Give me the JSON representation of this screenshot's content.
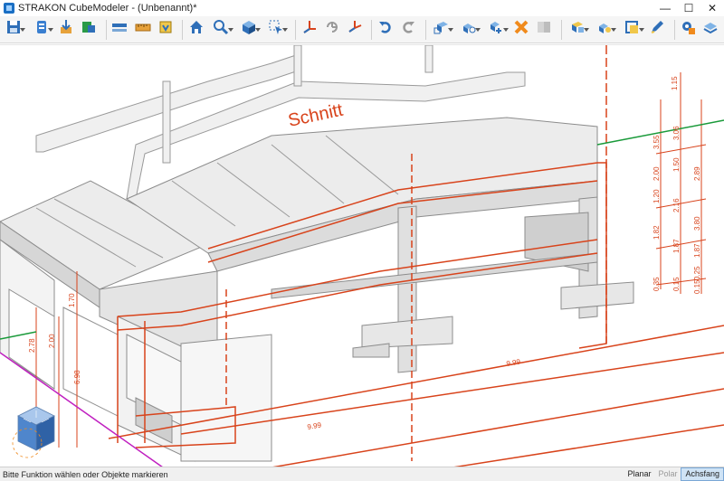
{
  "window": {
    "title": "STRAKON CubeModeler - (Unbenannt)*",
    "minimize_glyph": "—",
    "maximize_glyph": "☐",
    "close_glyph": "✕"
  },
  "toolbar": {
    "buttons": [
      {
        "name": "save-icon",
        "dropdown": true
      },
      {
        "name": "model-settings-icon",
        "dropdown": true
      },
      {
        "name": "import-icon",
        "dropdown": false
      },
      {
        "name": "export-icon",
        "dropdown": false
      },
      {
        "name": "measure-horizontal-icon",
        "dropdown": false
      },
      {
        "name": "ruler-icon",
        "dropdown": false
      },
      {
        "name": "view-box-icon",
        "dropdown": false
      },
      {
        "name": "home-icon",
        "dropdown": false
      },
      {
        "name": "zoom-icon",
        "dropdown": true
      },
      {
        "name": "cube-view-icon",
        "dropdown": true
      },
      {
        "name": "select-arrow-icon",
        "dropdown": true
      },
      {
        "name": "coordinate-axes-icon",
        "dropdown": false
      },
      {
        "name": "rotate-axes-icon",
        "dropdown": false
      },
      {
        "name": "align-axes-icon",
        "dropdown": false
      },
      {
        "name": "undo-icon",
        "dropdown": false
      },
      {
        "name": "redo-icon",
        "dropdown": false
      },
      {
        "name": "box-insert-icon",
        "dropdown": true
      },
      {
        "name": "group-objects-icon",
        "dropdown": true
      },
      {
        "name": "snap-objects-icon",
        "dropdown": true
      },
      {
        "name": "delete-icon",
        "dropdown": false
      },
      {
        "name": "panel-icon",
        "dropdown": false
      },
      {
        "name": "section-box-icon",
        "dropdown": true
      },
      {
        "name": "layers-icon",
        "dropdown": true
      },
      {
        "name": "properties-icon",
        "dropdown": true
      },
      {
        "name": "edit-pen-icon",
        "dropdown": false
      },
      {
        "name": "settings-gear-icon",
        "dropdown": false
      },
      {
        "name": "stack-layers-icon",
        "dropdown": false
      }
    ]
  },
  "viewport": {
    "section_label": "Schnitt",
    "dimensions": [
      "9.99",
      "9.99",
      "2.00",
      "2.78",
      "1.70",
      "6.98",
      "1.15",
      "3.55",
      "3.06",
      "1.50",
      "2.16",
      "2.00",
      "1.20",
      "1.82",
      "1.87",
      "2.89",
      "3.80",
      "1.87",
      "0.35",
      "0.15",
      "0.25",
      "0.15"
    ],
    "colors": {
      "section_red": "#d8431b",
      "model_gray": "#e8e8e8",
      "edge_gray": "#8c8c8c",
      "axis_green": "#1a9a3a",
      "axis_magenta": "#c020c0"
    }
  },
  "statusbar": {
    "hint": "Bitte Funktion wählen oder Objekte markieren",
    "modes": [
      "Planar",
      "Polar",
      "Achsfang"
    ]
  }
}
